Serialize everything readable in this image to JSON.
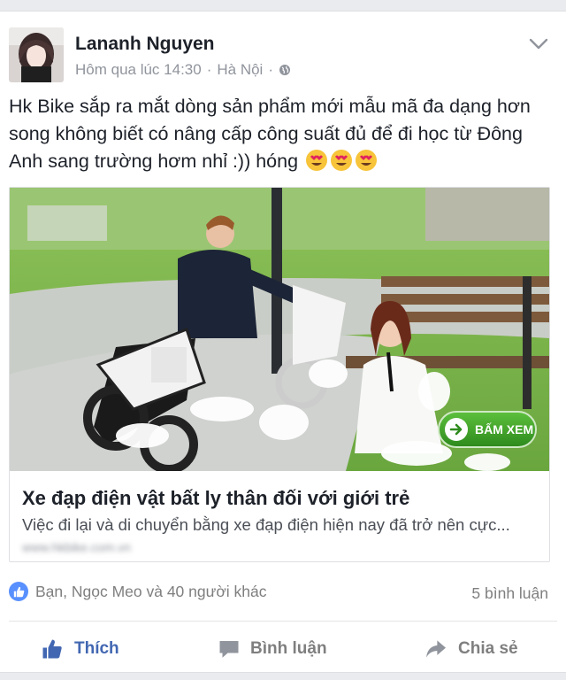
{
  "post": {
    "author": "Lananh Nguyen",
    "time": "Hôm qua lúc 14:30",
    "separator": "·",
    "location": "Hà Nội",
    "separator2": "·",
    "text_main": "Hk Bike sắp ra mắt dòng sản phẩm mới mẫu mã đa dạng hơn song không biết có nâng cấp công suất đủ để đi học từ Đông Anh sang trường hơm nhỉ :)) hóng",
    "emojis": [
      "heart-eyes-emoji",
      "heart-eyes-emoji",
      "heart-eyes-emoji"
    ]
  },
  "link": {
    "title": "Xe đạp điện vật bất ly thân đối với giới trẻ",
    "description": "Việc đi lại và di chuyển bằng xe đạp điện hiện nay đã trở nên cực...",
    "domain": "www.hkbike.com.vn",
    "cta_label": "BẤM XEM"
  },
  "stats": {
    "reactions_text": "Bạn, Ngọc Meo và 40 người khác",
    "comments_text": "5 bình luận"
  },
  "actions": {
    "like": "Thích",
    "comment": "Bình luận",
    "share": "Chia sẻ"
  },
  "colors": {
    "brand": "#4267b2",
    "muted": "#90949c",
    "cta": "#3aa028"
  }
}
